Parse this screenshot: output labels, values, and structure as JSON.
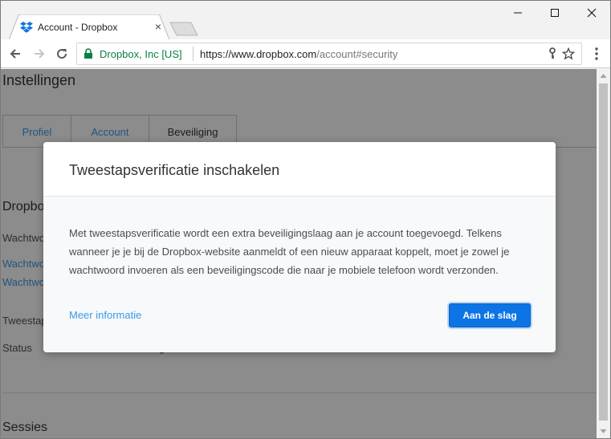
{
  "browser": {
    "tab_title": "Account - Dropbox",
    "tab_close": "×",
    "secure_label": "Dropbox, Inc [US]",
    "url_scheme_host": "https://www.dropbox.com",
    "url_path": "/account#security"
  },
  "page": {
    "title": "Instellingen",
    "tabs": [
      {
        "label": "Profiel"
      },
      {
        "label": "Account"
      },
      {
        "label": "Beveiliging"
      }
    ],
    "dropbox_heading": "Dropbox",
    "password_label": "Wachtwoord",
    "password_link_1": "Wachtwoord",
    "password_link_2": "Wachtwoord",
    "two_step_label": "Tweestapsverificatie",
    "status_label": "Status",
    "status_value": "g",
    "sessions_heading": "Sessies"
  },
  "modal": {
    "title": "Tweestapsverificatie inschakelen",
    "body": "Met tweestapsverificatie wordt een extra beveiligingslaag aan je account toegevoegd. Telkens wanneer je je bij de Dropbox-website aanmeldt of een nieuw apparaat koppelt, moet je zowel je wachtwoord invoeren als een beveiligingscode die naar je mobiele telefoon wordt verzonden.",
    "more_link": "Meer informatie",
    "primary_button": "Aan de slag"
  },
  "colors": {
    "link": "#3d9ae8",
    "primary_button": "#0d74e5",
    "secure_green": "#0b8043"
  }
}
